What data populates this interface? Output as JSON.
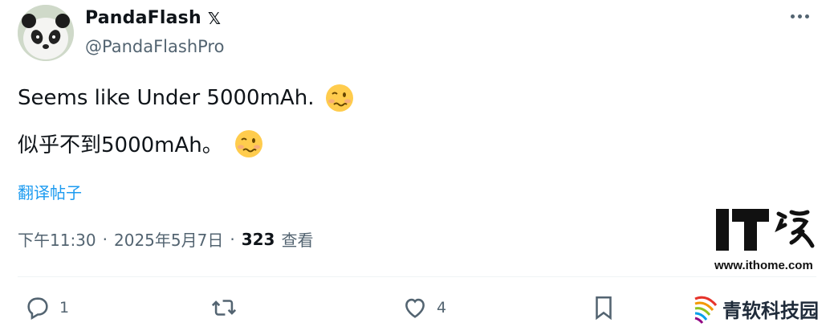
{
  "tweet": {
    "display_name": "PandaFlash",
    "x_badge": "𝕏",
    "handle": "@PandaFlashPro",
    "line1": "Seems like Under 5000mAh.",
    "line2": "似乎不到5000mAh。",
    "emoji": "woozy-face",
    "translate_label": "翻译帖子",
    "time": "下午11:30",
    "separator": "·",
    "date": "2025年5月7日",
    "views_count": "323",
    "views_label": "查看"
  },
  "actions": {
    "reply_count": "",
    "reply_count_display": "1",
    "retweet_count": "",
    "like_count": "4"
  },
  "watermarks": {
    "ithome_logo_text": "IT之家",
    "ithome_url": "www.ithome.com",
    "qingruan_text": "青软科技园"
  },
  "colors": {
    "text": "#0f1419",
    "secondary": "#536471",
    "link": "#1d9bf0",
    "divider": "#eff3f4"
  }
}
